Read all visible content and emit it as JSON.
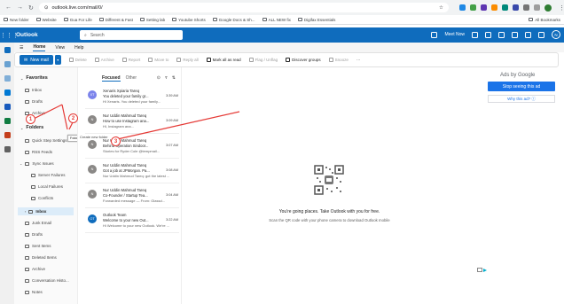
{
  "browser": {
    "url": "outlook.live.com/mail/0/",
    "bookmarks": [
      "New folder",
      "Website",
      "Gua For Life",
      "Different & Fast",
      "Setting lab",
      "Youtube Shorts",
      "Google Docs & Sh...",
      "ALL NEW fix",
      "Digifax Essentials"
    ],
    "all_bookmarks": "All Bookmarks",
    "nav_icons": [
      "back-arrow-icon",
      "forward-arrow-icon",
      "reload-icon"
    ]
  },
  "outlook_header": {
    "app_title": "Outlook",
    "search_placeholder": "Search",
    "meet_now": "Meet Now",
    "avatar_initials": "N"
  },
  "ribbon": {
    "tabs": [
      "Home",
      "View",
      "Help"
    ],
    "new_mail": "New mail",
    "buttons": [
      {
        "label": "Delete",
        "enabled": false
      },
      {
        "label": "Archive",
        "enabled": false
      },
      {
        "label": "Report",
        "enabled": false
      },
      {
        "label": "Move to",
        "enabled": false
      },
      {
        "label": "Reply all",
        "enabled": false
      },
      {
        "label": "Mark all as read",
        "enabled": true
      },
      {
        "label": "Flag / Unflag",
        "enabled": false
      },
      {
        "label": "Discover groups",
        "enabled": true
      },
      {
        "label": "Snooze",
        "enabled": false
      }
    ],
    "more": "···"
  },
  "folder_pane": {
    "favorites_label": "Favorites",
    "favorites": [
      "Inbox",
      "Drafts",
      "Archive"
    ],
    "folders_label": "Folders",
    "folders": [
      {
        "label": "Quick Step Settings",
        "indent": 0,
        "selected": false
      },
      {
        "label": "RSS Feeds",
        "indent": 0,
        "selected": false
      },
      {
        "label": "Sync Issues",
        "indent": 0,
        "expanded": true,
        "selected": false
      },
      {
        "label": "Server Failures",
        "indent": 1,
        "selected": false
      },
      {
        "label": "Local Failures",
        "indent": 1,
        "selected": false
      },
      {
        "label": "Conflicts",
        "indent": 1,
        "selected": false
      },
      {
        "label": "Inbox",
        "indent": 0,
        "expanded": true,
        "selected": true
      },
      {
        "label": "Junk Email",
        "indent": 0,
        "selected": false
      },
      {
        "label": "Drafts",
        "indent": 0,
        "selected": false
      },
      {
        "label": "Sent Items",
        "indent": 0,
        "selected": false
      },
      {
        "label": "Deleted Items",
        "indent": 0,
        "selected": false
      },
      {
        "label": "Archive",
        "indent": 0,
        "selected": false
      },
      {
        "label": "Conversation Histo...",
        "indent": 0,
        "selected": false
      },
      {
        "label": "Notes",
        "indent": 0,
        "selected": false
      }
    ],
    "tooltip": "Folders",
    "new_folder_text": "Create new folder"
  },
  "message_list": {
    "tabs": [
      "Focused",
      "Other"
    ],
    "messages": [
      {
        "initials": "XT",
        "color": "#7b83eb",
        "from": "Xenaris Xpiaria Tareq",
        "subject": "You deleted your family gr...",
        "time": "3:39 AM",
        "preview": "Hi Xenaris. You deleted your family..."
      },
      {
        "initials": "N",
        "color": "#8a8886",
        "from": "Nur Uddin Mahmud Tareq",
        "subject": "How to use Instagram ana...",
        "time": "3:09 AM",
        "preview": "Hi, Instagram ana..."
      },
      {
        "initials": "N",
        "color": "#8a8886",
        "from": "Nur Uddin Mahmud Tareq",
        "subject": "Behind Operation Sindoor...",
        "time": "3:07 AM",
        "preview": "Stories for Ryder Cole @tempmail..."
      },
      {
        "initials": "N",
        "color": "#8a8886",
        "from": "Nur Uddin Mahmud Tareq",
        "subject": "Got a job at JPMorgan. Pa...",
        "time": "3:08 AM",
        "preview": "Nur Uddin Mahmud Tareq: got the latest ..."
      },
      {
        "initials": "N",
        "color": "#8a8886",
        "from": "Nur Uddin Mahmud Tareq",
        "subject": "Co-Founder / Startup Tea...",
        "time": "3:04 AM",
        "preview": "Forwarded message — From: Glassd..."
      },
      {
        "initials": "OT",
        "color": "#0f6cbd",
        "from": "Outlook Team",
        "subject": "Welcome to your new Out...",
        "time": "3:22 AM",
        "preview": "Hi Welcome to your new Outlook. We're ..."
      }
    ]
  },
  "reading_pane": {
    "title": "You're going places. Take Outlook with you for free.",
    "subtitle": "Scan the QR code with your phone camera to download Outlook mobile"
  },
  "ads": {
    "label": "Ads by Google",
    "stop_button": "Stop seeing this ad",
    "why_button": "Why this ad? ⓘ"
  },
  "overlay": {
    "markers": [
      "1",
      "2",
      "3"
    ],
    "annotation_color": "#e53935"
  }
}
